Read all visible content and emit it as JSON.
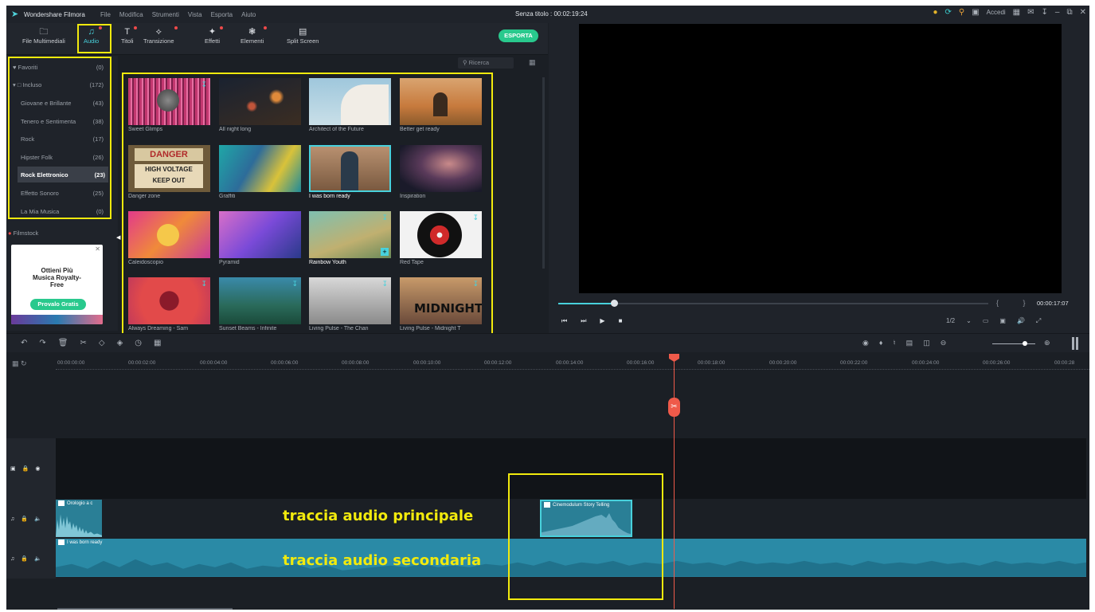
{
  "titlebar": {
    "app_name": "Wondershare Filmora",
    "menu": [
      "File",
      "Modifica",
      "Strumenti",
      "Vista",
      "Esporta",
      "Aiuto"
    ],
    "window_title": "Senza titolo : 00:02:19:24",
    "login": "Accedi"
  },
  "toolbar": {
    "tabs": [
      {
        "label": "File Multimediali",
        "icon": "folder-icon"
      },
      {
        "label": "Audio",
        "icon": "music-note-icon",
        "active": true
      },
      {
        "label": "Titoli",
        "icon": "title-icon"
      },
      {
        "label": "Transizione",
        "icon": "transition-icon"
      },
      {
        "label": "Effetti",
        "icon": "effects-icon"
      },
      {
        "label": "Elementi",
        "icon": "elements-icon"
      },
      {
        "label": "Split Screen",
        "icon": "split-screen-icon"
      }
    ],
    "export_label": "ESPORTA"
  },
  "sidebar": {
    "favorites": {
      "label": "Favoriti",
      "count": "(0)"
    },
    "included": {
      "label": "Incluso",
      "count": "(172)"
    },
    "categories": [
      {
        "label": "Giovane e Brillante",
        "count": "(43)"
      },
      {
        "label": "Tenero e Sentimenta",
        "count": "(38)"
      },
      {
        "label": "Rock",
        "count": "(17)"
      },
      {
        "label": "Hipster Folk",
        "count": "(26)"
      },
      {
        "label": "Rock Elettronico",
        "count": "(23)",
        "selected": true
      },
      {
        "label": "Effetto Sonoro",
        "count": "(25)"
      },
      {
        "label": "La Mia Musica",
        "count": "(0)"
      }
    ],
    "filmstock": "Filmstock",
    "promo": {
      "line1": "Ottieni Più",
      "line2": "Musica Royalty-",
      "line3": "Free",
      "button": "Provalo Gratis"
    }
  },
  "media": {
    "search_placeholder": "Ricerca",
    "items": [
      "Sweet Glimps",
      "All night long",
      "Architect of the Future",
      "Better get ready",
      "Danger zone",
      "Graffiti",
      "I was born ready",
      "Inspiration",
      "Caleidoscopio",
      "Pyramid",
      "Rainbow Youth",
      "Red Tape",
      "Always Dreaming - Sam",
      "Sunset Beams - Infinite",
      "Living Pulse - The Chan",
      "Living Pulse - Midnight T"
    ],
    "thumb_text": {
      "danger": "DANGER",
      "voltage": "HIGH VOLTAGE",
      "keep": "KEEP OUT",
      "midnight": "MIDNIGHT"
    }
  },
  "preview": {
    "timecode": "00:00:17:07",
    "quality": "1/2",
    "progress": 0.13
  },
  "ruler": {
    "labels": [
      "00:00:00:00",
      "00:00:02:00",
      "00:00:04:00",
      "00:00:06:00",
      "00:00:08:00",
      "00:00:10:00",
      "00:00:12:00",
      "00:00:14:00",
      "00:00:16:00",
      "00:00:18:00",
      "00:00:20:00",
      "00:00:22:00",
      "00:00:24:00",
      "00:00:26:00",
      "00:00:28"
    ]
  },
  "timeline": {
    "playhead_time": "00:00:16:00",
    "clips": {
      "orologio": "Orologio a c",
      "storytelling": "Cinemodulum Story Telling",
      "born_ready": "I was born ready"
    }
  },
  "annotations": {
    "primary": "traccia audio principale",
    "secondary": "traccia audio secondaria"
  },
  "colors": {
    "accent": "#48d1dc",
    "highlight": "#f2ea0d",
    "playhead": "#ef5a4a",
    "export": "#29c98d",
    "clip": "#2a7f96"
  }
}
